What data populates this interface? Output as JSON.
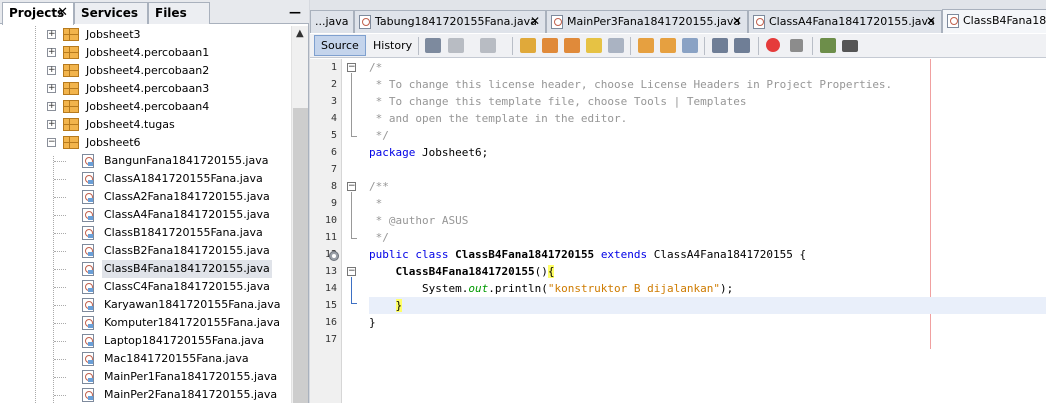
{
  "left_panel": {
    "tabs": [
      {
        "label": "Projects",
        "closable": true
      },
      {
        "label": "Services",
        "closable": false
      },
      {
        "label": "Files",
        "closable": false
      }
    ],
    "minimize_label": "—",
    "tree": [
      {
        "type": "package",
        "label": "Jobsheet3",
        "toggle": "+"
      },
      {
        "type": "package",
        "label": "Jobsheet4.percobaan1",
        "toggle": "+"
      },
      {
        "type": "package",
        "label": "Jobsheet4.percobaan2",
        "toggle": "+"
      },
      {
        "type": "package",
        "label": "Jobsheet4.percobaan3",
        "toggle": "+"
      },
      {
        "type": "package",
        "label": "Jobsheet4.percobaan4",
        "toggle": "+"
      },
      {
        "type": "package",
        "label": "Jobsheet4.tugas",
        "toggle": "+"
      },
      {
        "type": "package",
        "label": "Jobsheet6",
        "toggle": "−"
      },
      {
        "type": "file",
        "label": "BangunFana1841720155.java"
      },
      {
        "type": "file",
        "label": "ClassA1841720155Fana.java"
      },
      {
        "type": "file",
        "label": "ClassA2Fana1841720155.java"
      },
      {
        "type": "file",
        "label": "ClassA4Fana1841720155.java"
      },
      {
        "type": "file",
        "label": "ClassB1841720155Fana.java"
      },
      {
        "type": "file",
        "label": "ClassB2Fana1841720155.java"
      },
      {
        "type": "file",
        "label": "ClassB4Fana1841720155.java",
        "selected": true
      },
      {
        "type": "file",
        "label": "ClassC4Fana1841720155.java"
      },
      {
        "type": "file",
        "label": "Karyawan1841720155Fana.java"
      },
      {
        "type": "file",
        "label": "Komputer1841720155Fana.java"
      },
      {
        "type": "file",
        "label": "Laptop1841720155Fana.java"
      },
      {
        "type": "file",
        "label": "Mac1841720155Fana.java"
      },
      {
        "type": "file",
        "label": "MainPer1Fana1841720155.java"
      },
      {
        "type": "file",
        "label": "MainPer2Fana1841720155.java"
      }
    ]
  },
  "editor": {
    "tabs": [
      {
        "label": "...java",
        "icon": "java-file-icon",
        "closable": false
      },
      {
        "label": "Tabung1841720155Fana.java",
        "closable": true
      },
      {
        "label": "MainPer3Fana1841720155.java",
        "closable": true
      },
      {
        "label": "ClassA4Fana1841720155.java",
        "closable": true
      },
      {
        "label": "ClassB4Fana184",
        "closable": false,
        "active": true
      }
    ],
    "toolbar": {
      "source_label": "Source",
      "history_label": "History"
    },
    "lines": [
      {
        "n": "1",
        "text": "/*"
      },
      {
        "n": "2",
        "text": " * To change this license header, choose License Headers in Project Properties."
      },
      {
        "n": "3",
        "text": " * To change this template file, choose Tools | Templates"
      },
      {
        "n": "4",
        "text": " * and open the template in the editor."
      },
      {
        "n": "5",
        "text": " */"
      },
      {
        "n": "6",
        "kw": "package",
        "text": " Jobsheet6;"
      },
      {
        "n": "7",
        "text": ""
      },
      {
        "n": "8",
        "text": "/**"
      },
      {
        "n": "9",
        "text": " *"
      },
      {
        "n": "10",
        "text": " * @author ASUS"
      },
      {
        "n": "11",
        "text": " */"
      },
      {
        "n": "12",
        "kw1": "public class",
        "cls": "ClassB4Fana1841720155",
        "kw2": "extends",
        "rest": "ClassA4Fana1841720155 {"
      },
      {
        "n": "13",
        "indent": "    ",
        "ctor": "ClassB4Fana1841720155",
        "paren": "()",
        "brace": "{"
      },
      {
        "n": "14",
        "indent": "        ",
        "pre": "System.",
        "field": "out",
        "mid": ".println(",
        "str": "\"konstruktor B dijalankan\"",
        "post": ");"
      },
      {
        "n": "15",
        "indent": "    ",
        "brace": "}"
      },
      {
        "n": "16",
        "text": "}"
      },
      {
        "n": "17",
        "text": ""
      }
    ]
  }
}
